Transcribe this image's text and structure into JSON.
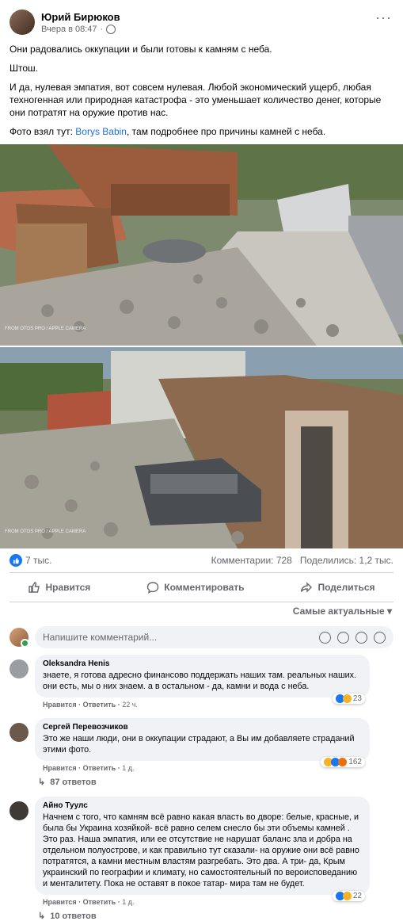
{
  "post": {
    "author": "Юрий Бирюков",
    "time": "Вчера в 08:47",
    "more": "···",
    "text1": "Они радовались оккупации и были готовы к камням с неба.",
    "text2": "Штош.",
    "text3": "И да, нулевая эмпатия, вот совсем нулевая. Любой экономический ущерб, любая техногенная или природная катастрофа - это уменьшает количество денег, которые они потратят на оружие против нас.",
    "text4_prefix": "Фото взял тут: ",
    "text4_link": "Borys Babin",
    "text4_suffix": ", там подробнее про причины камней с неба.",
    "photo_watermark": "FROM OTOS PRO / APPLE CAMERA"
  },
  "stats": {
    "likes": "7 тыс.",
    "comments": "Комментарии: 728",
    "shares": "Поделились: 1,2 тыс."
  },
  "actions": {
    "like": "Нравится",
    "comment": "Комментировать",
    "share": "Поделиться"
  },
  "sort": "Самые актуальные",
  "comment_input": {
    "placeholder": "Напишите комментарий..."
  },
  "comments": [
    {
      "name": "Oleksandra Henis",
      "text": "знаете, я готова адресно финансово поддержать наших там. реальных наших. они есть, мы о них знаем. а в остальном - да, камни и вода с неба.",
      "like": "Нравится",
      "reply": "Ответить",
      "time": "22 ч.",
      "reactions": "23"
    },
    {
      "name": "Сергей Перевозчиков",
      "text": "Это же наши люди, они в оккупации страдают, а Вы им добавляете страданий этими фото.",
      "like": "Нравится",
      "reply": "Ответить",
      "time": "1 д.",
      "reactions": "162",
      "replies": "87 ответов"
    },
    {
      "name": "Айно Туулс",
      "text": "Начнем с того, что камням всё равно какая власть во дворе: белые, красные, и была бы Украина хозяйкой- всё равно селем снесло бы эти объемы камней . Это раз. Наша эмпатия, или ее отсутствие не нарушат баланс зла и добра на отдельном полуострове, и как правильно тут сказали- на оружие они всё равно потратятся, а камни местным властям разгребать. Это два. А три- да, Крым украинский по географии и климату, но самостоятельный по вероисповеданию и менталитету. Пока не оставят в покое татар- мира там не будет.",
      "like": "Нравится",
      "reply": "Ответить",
      "time": "1 д.",
      "reactions": "22",
      "replies": "10 ответов"
    }
  ]
}
